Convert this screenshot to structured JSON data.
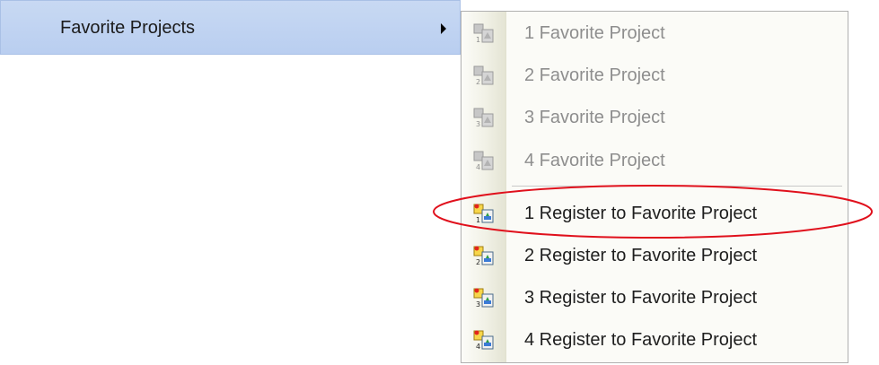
{
  "parent_menu": {
    "label": "Favorite Projects",
    "arrow_icon": "submenu-arrow-icon"
  },
  "submenu": {
    "open_items": [
      {
        "label": "1 Favorite Project",
        "icon": "favorite-project-icon",
        "enabled": false
      },
      {
        "label": "2 Favorite Project",
        "icon": "favorite-project-icon",
        "enabled": false
      },
      {
        "label": "3 Favorite Project",
        "icon": "favorite-project-icon",
        "enabled": false
      },
      {
        "label": "4 Favorite Project",
        "icon": "favorite-project-icon",
        "enabled": false
      }
    ],
    "register_items": [
      {
        "label": "1 Register to Favorite Project",
        "icon": "register-favorite-project-icon",
        "enabled": true,
        "highlighted": true
      },
      {
        "label": "2 Register to Favorite Project",
        "icon": "register-favorite-project-icon",
        "enabled": true
      },
      {
        "label": "3 Register to Favorite Project",
        "icon": "register-favorite-project-icon",
        "enabled": true
      },
      {
        "label": "4 Register to Favorite Project",
        "icon": "register-favorite-project-icon",
        "enabled": true
      }
    ]
  },
  "colors": {
    "parent_highlight": "#c8d9f3",
    "annotation_ellipse": "#e0101c",
    "disabled_text": "#8e8e8e"
  }
}
